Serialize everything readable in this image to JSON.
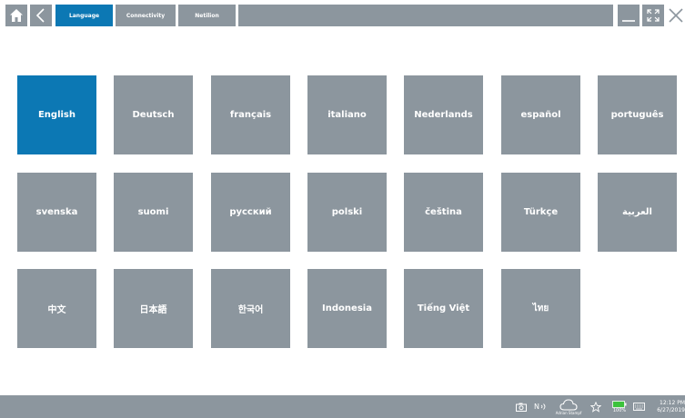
{
  "tabs": [
    {
      "label": "Language"
    },
    {
      "label": "Connectivity"
    },
    {
      "label": "Netilion"
    }
  ],
  "languages": [
    "English",
    "Deutsch",
    "français",
    "italiano",
    "Nederlands",
    "español",
    "português",
    "svenska",
    "suomi",
    "русский",
    "polski",
    "čeština",
    "Türkçe",
    "العربية",
    "中文",
    "日本語",
    "한국어",
    "Indonesia",
    "Tiếng Việt",
    "ไทย"
  ],
  "selected_language": "English",
  "status": {
    "network_label": "N",
    "cloud_user": "Adrian Stampf",
    "battery": "100%",
    "time": "12:12 PM",
    "date": "6/27/2019"
  },
  "colors": {
    "accent": "#0c78b4",
    "tile": "#8c969e"
  }
}
